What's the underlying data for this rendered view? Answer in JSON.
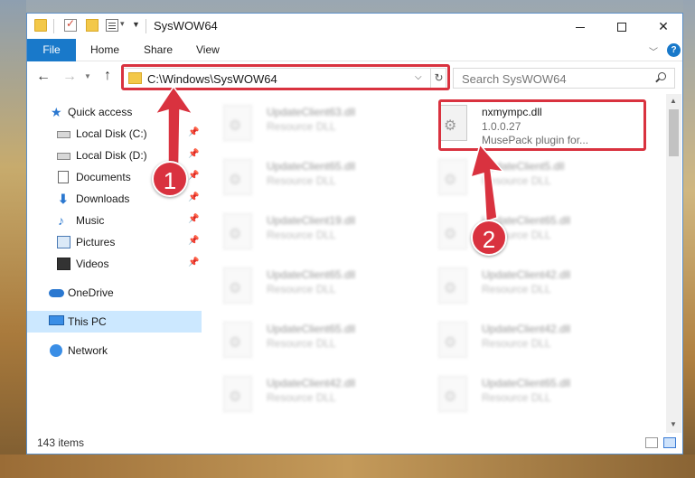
{
  "window": {
    "title": "SysWOW64"
  },
  "ribbon": {
    "tabs": [
      "File",
      "Home",
      "Share",
      "View"
    ],
    "help": "?"
  },
  "address": {
    "path": "C:\\Windows\\SysWOW64"
  },
  "search": {
    "placeholder": "Search SysWOW64"
  },
  "sidebar": {
    "items": [
      {
        "label": "Quick access",
        "icon": "star-icon",
        "pinned": false
      },
      {
        "label": "Local Disk (C:)",
        "icon": "disk-icon",
        "pinned": true
      },
      {
        "label": "Local Disk (D:)",
        "icon": "disk-icon",
        "pinned": true
      },
      {
        "label": "Documents",
        "icon": "documents-icon",
        "pinned": true
      },
      {
        "label": "Downloads",
        "icon": "download-icon",
        "pinned": true
      },
      {
        "label": "Music",
        "icon": "music-icon",
        "pinned": true
      },
      {
        "label": "Pictures",
        "icon": "pictures-icon",
        "pinned": true
      },
      {
        "label": "Videos",
        "icon": "videos-icon",
        "pinned": true
      },
      {
        "label": "OneDrive",
        "icon": "cloud-icon",
        "pinned": false
      },
      {
        "label": "This PC",
        "icon": "pc-icon",
        "pinned": false,
        "selected": true
      },
      {
        "label": "Network",
        "icon": "network-icon",
        "pinned": false
      }
    ]
  },
  "files": {
    "highlighted": {
      "name": "nxmympc.dll",
      "version": "1.0.0.27",
      "description": "MusePack plugin for..."
    },
    "left_column": [
      {
        "name": "UpdateClient63.dll",
        "type": "Resource DLL"
      },
      {
        "name": "UpdateClient65.dll",
        "type": "Resource DLL"
      },
      {
        "name": "UpdateClient19.dll",
        "type": "Resource DLL"
      },
      {
        "name": "UpdateClient65.dll",
        "type": "Resource DLL"
      },
      {
        "name": "UpdateClient65.dll",
        "type": "Resource DLL"
      },
      {
        "name": "UpdateClient42.dll",
        "type": "Resource DLL"
      }
    ],
    "right_column": [
      {
        "name": "UpdateClient5.dll",
        "type": "Resource DLL"
      },
      {
        "name": "UpdateClient65.dll",
        "type": "Resource DLL"
      },
      {
        "name": "UpdateClient42.dll",
        "type": "Resource DLL"
      },
      {
        "name": "UpdateClient42.dll",
        "type": "Resource DLL"
      },
      {
        "name": "UpdateClient65.dll",
        "type": "Resource DLL"
      }
    ]
  },
  "status": {
    "item_count": "143 items"
  },
  "annotations": {
    "step1": "1",
    "step2": "2",
    "color": "#d9323f"
  }
}
